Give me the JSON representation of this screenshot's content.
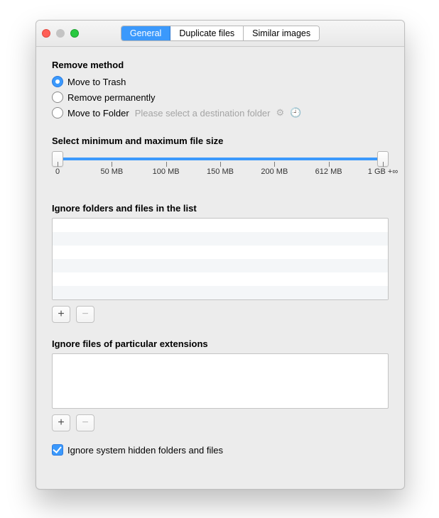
{
  "tabs": [
    "General",
    "Duplicate files",
    "Similar images"
  ],
  "active_tab": 0,
  "remove_method": {
    "heading": "Remove method",
    "options": [
      {
        "label": "Move to Trash",
        "checked": true
      },
      {
        "label": "Remove permanently",
        "checked": false
      },
      {
        "label": "Move to Folder",
        "checked": false,
        "hint": "Please select a destination folder"
      }
    ]
  },
  "size_slider": {
    "heading": "Select minimum and maximum file size",
    "labels": [
      "0",
      "50 MB",
      "100 MB",
      "150 MB",
      "200 MB",
      "612 MB",
      "1 GB +∞"
    ]
  },
  "ignore_list": {
    "heading": "Ignore folders and files in the list"
  },
  "ignore_ext": {
    "heading": "Ignore files of particular extensions"
  },
  "ignore_hidden": {
    "label": "Ignore system hidden folders and files",
    "checked": true
  },
  "glyphs": {
    "plus": "+",
    "minus": "−",
    "gear": "⚙",
    "clock": "🕘"
  }
}
